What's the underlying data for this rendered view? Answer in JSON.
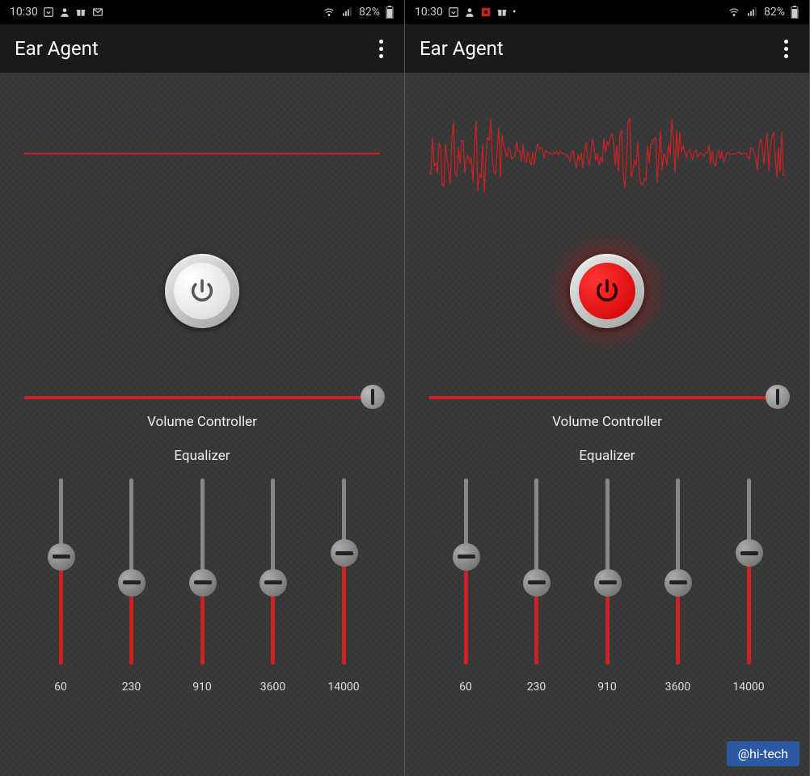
{
  "status": {
    "time": "10:30",
    "battery": "82%"
  },
  "app": {
    "title": "Ear Agent"
  },
  "screens": [
    {
      "power_on": false,
      "waveform_active": false,
      "volume_label": "Volume Controller",
      "volume_percent": 100,
      "equalizer_label": "Equalizer",
      "eq_bands": [
        {
          "freq": "60",
          "value": 58
        },
        {
          "freq": "230",
          "value": 44
        },
        {
          "freq": "910",
          "value": 44
        },
        {
          "freq": "3600",
          "value": 44
        },
        {
          "freq": "14000",
          "value": 60
        }
      ]
    },
    {
      "power_on": true,
      "waveform_active": true,
      "volume_label": "Volume Controller",
      "volume_percent": 100,
      "equalizer_label": "Equalizer",
      "eq_bands": [
        {
          "freq": "60",
          "value": 58
        },
        {
          "freq": "230",
          "value": 44
        },
        {
          "freq": "910",
          "value": 44
        },
        {
          "freq": "3600",
          "value": 44
        },
        {
          "freq": "14000",
          "value": 60
        }
      ]
    }
  ],
  "watermark": "@hi-tech"
}
